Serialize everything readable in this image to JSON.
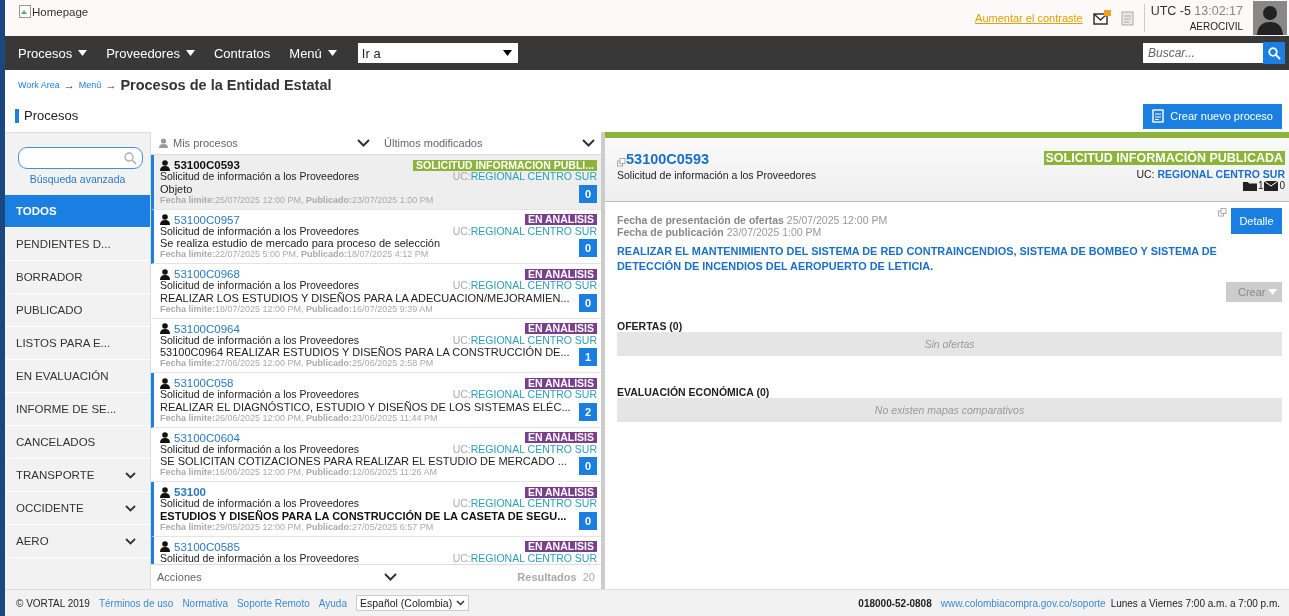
{
  "header": {
    "logo_alt": "Homepage",
    "contrast_link": "Aumentar el contraste",
    "timezone": "UTC -5",
    "time": "13:02:17",
    "user": "AEROCIVIL"
  },
  "nav": {
    "menus": [
      {
        "label": "Procesos",
        "dropdown": true
      },
      {
        "label": "Proveedores",
        "dropdown": true
      },
      {
        "label": "Contratos",
        "dropdown": false
      },
      {
        "label": "Menú",
        "dropdown": true
      }
    ],
    "goto": {
      "value": "Ir a"
    },
    "search": {
      "placeholder": "Buscar..."
    }
  },
  "breadcrumb": {
    "arrow": "→",
    "links": [
      "Work Area",
      "Menú"
    ],
    "current": "Procesos de la Entidad Estatal"
  },
  "page_title": "Procesos",
  "create_button": "Crear nuevo proceso",
  "sidebar": {
    "advanced_search": "Búsqueda avanzada",
    "items": [
      {
        "label": "TODOS",
        "selected": true,
        "expandable": false
      },
      {
        "label": "PENDIENTES D...",
        "selected": false,
        "expandable": false
      },
      {
        "label": "BORRADOR",
        "selected": false,
        "expandable": false
      },
      {
        "label": "PUBLICADO",
        "selected": false,
        "expandable": false
      },
      {
        "label": "LISTOS PARA E...",
        "selected": false,
        "expandable": false
      },
      {
        "label": "EN EVALUACIÓN",
        "selected": false,
        "expandable": false
      },
      {
        "label": "INFORME DE SE...",
        "selected": false,
        "expandable": false
      },
      {
        "label": "CANCELADOS",
        "selected": false,
        "expandable": false
      },
      {
        "label": "TRANSPORTE",
        "selected": false,
        "expandable": true
      },
      {
        "label": "OCCIDENTE",
        "selected": false,
        "expandable": true
      },
      {
        "label": "AERO",
        "selected": false,
        "expandable": true
      }
    ]
  },
  "list": {
    "filter": "Mis procesos",
    "sort": "Últimos modificados",
    "actions": "Acciones",
    "results_label": "Resultados",
    "results_count": "20",
    "items": [
      {
        "id": "53100C0593",
        "type": "Solicitud de información a los Proveedores",
        "title": "Objeto",
        "dates": "**Fecha limite:**25/07/2025 12:00 PM, **Publicado:**23/07/2025 1:00 PM",
        "status": "SOLICITUD INFORMACION PUBLI...",
        "color": "#8cb33a",
        "uc_label": "UC:",
        "uc": "REGIONAL CENTRO SUR",
        "count": "0",
        "selected": true,
        "flagged": true,
        "bold": false
      },
      {
        "id": "53100C0957",
        "type": "Solicitud de información a los Proveedores",
        "title": "Se realiza estudio de mercado para proceso de selección",
        "dates": "**Fecha limite:**22/07/2025 5:00 PM, **Publicado:**18/07/2025 4:12 PM",
        "status": "EN ANÁLISIS",
        "color": "#7b3e8e",
        "uc_label": "UC:",
        "uc": "REGIONAL CENTRO SUR",
        "count": "0",
        "selected": false,
        "flagged": true,
        "bold": false
      },
      {
        "id": "53100C0968",
        "type": "Solicitud de información a los Proveedores",
        "title": "REALIZAR LOS ESTUDIOS Y DISEÑOS PARA LA ADECUACION/MEJORAMIEN...",
        "dates": "**Fecha limite:**18/07/2025 12:00 PM, **Publicado:**16/07/2025 9:39 AM",
        "status": "EN ANÁLISIS",
        "color": "#7b3e8e",
        "uc_label": "UC:",
        "uc": "REGIONAL CENTRO SUR",
        "count": "0",
        "selected": false,
        "flagged": false,
        "bold": false
      },
      {
        "id": "53100C0964",
        "type": "Solicitud de información a los Proveedores",
        "title": "53100C0964 REALIZAR ESTUDIOS Y DISEÑOS PARA LA CONSTRUCCIÓN DE...",
        "dates": "**Fecha limite:**27/06/2025 12:00 PM, **Publicado:**25/06/2025 2:58 PM",
        "status": "EN ANÁLISIS",
        "color": "#7b3e8e",
        "uc_label": "UC:",
        "uc": "REGIONAL CENTRO SUR",
        "count": "1",
        "selected": false,
        "flagged": false,
        "bold": false
      },
      {
        "id": "53100C058",
        "type": "Solicitud de información a los Proveedores",
        "title": "REALIZAR EL DIAGNÓSTICO, ESTUDIO Y DISEÑOS DE LOS SISTEMAS ELÉC...",
        "dates": "**Fecha limite:**26/06/2025 12:00 PM, **Publicado:**23/06/2025 11:44 PM",
        "status": "EN ANÁLISIS",
        "color": "#7b3e8e",
        "uc_label": "UC:",
        "uc": "REGIONAL CENTRO SUR",
        "count": "2",
        "selected": false,
        "flagged": true,
        "bold": false
      },
      {
        "id": "53100C0604",
        "type": "Solicitud de información a los Proveedores",
        "title": "SE SOLICITAN COTIZACIONES PARA REALIZAR EL ESTUDIO DE MERCADO ...",
        "dates": "**Fecha limite:**16/06/2025 12:00 PM, **Publicado:**12/06/2025 11:26 AM",
        "status": "EN ANÁLISIS",
        "color": "#7b3e8e",
        "uc_label": "UC:",
        "uc": "REGIONAL CENTRO SUR",
        "count": "0",
        "selected": false,
        "flagged": false,
        "bold": false
      },
      {
        "id": "53100",
        "type": "Solicitud de información a los Proveedores",
        "title": "ESTUDIOS Y DISEÑOS PARA LA CONSTRUCCIÓN DE LA CASETA DE SEGU...",
        "dates": "**Fecha limite:**29/05/2025 12:00 PM, **Publicado:**27/05/2025 6:57 PM",
        "status": "EN ANÁLISIS",
        "color": "#7b3e8e",
        "uc_label": "UC:",
        "uc": "REGIONAL CENTRO SUR",
        "count": "0",
        "selected": false,
        "flagged": true,
        "bold": true
      },
      {
        "id": "53100C0585",
        "type": "Solicitud de información a los Proveedores",
        "status": "EN ANÁLISIS",
        "color": "#7b3e8e",
        "uc_label": "UC:",
        "uc": "REGIONAL CENTRO SUR",
        "selected": false,
        "flagged": true,
        "bold": false
      }
    ]
  },
  "detail": {
    "id": "53100C0593",
    "type": "Solicitud de información a los Proveedores",
    "status": "SOLICITUD INFORMACIÓN PUBLICADA",
    "uc_label": "UC:",
    "uc": "REGIONAL CENTRO SUR",
    "folders": "1",
    "messages": "0",
    "dates": "**Fecha de presentación de ofertas** 25/07/2025 12:00 PM",
    "dates2": "**Fecha de publicación** 23/07/2025 1:00 PM",
    "detail_button": "Detalle",
    "title": "REALIZAR EL MANTENIMIENTO DEL SISTEMA DE RED CONTRAINCENDIOS, SISTEMA DE BOMBEO Y SISTEMA DE DETECCIÓN DE INCENDIOS DEL AEROPUERTO DE LETICIA.",
    "create_button": "Crear",
    "sections": [
      {
        "heading": "OFERTAS (0)",
        "empty": "Sin ofertas"
      },
      {
        "heading": "EVALUACIÓN ECONÓMICA (0)",
        "empty": "No existen mapas comparativos"
      }
    ]
  },
  "footer": {
    "copyright": "© VORTAL 2019",
    "links": [
      "Términos de uso",
      "Normativa",
      "Soporte Remoto",
      "Ayuda"
    ],
    "language": "Español (Colombia)",
    "phone": "018000-52-0808",
    "support_link": "www.colombiacompra.gov.co/soporte",
    "hours": "Lunes a Viernes 7:00 a.m. a 7:00 p.m."
  }
}
